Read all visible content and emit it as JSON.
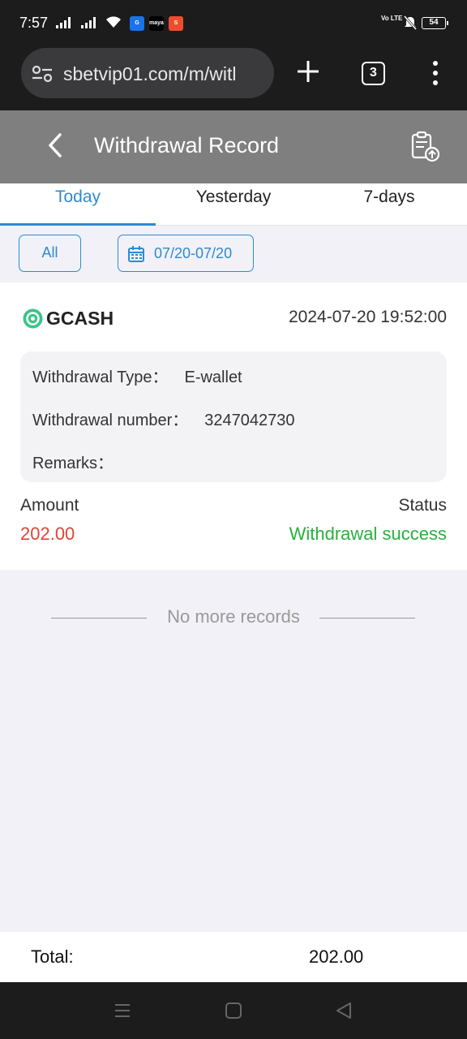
{
  "status_bar": {
    "time": "7:57",
    "volte": "Vo LTE",
    "battery": "54",
    "app_icons": [
      {
        "name": "gcash-app-icon",
        "label": "G",
        "color": "#1a73e8"
      },
      {
        "name": "maya-app-icon",
        "label": "maya",
        "color": "#000000"
      },
      {
        "name": "shopee-app-icon",
        "label": "S",
        "color": "#ee4d2d"
      }
    ]
  },
  "browser": {
    "url": "sbetvip01.com/m/witl",
    "tab_count": "3"
  },
  "header": {
    "title": "Withdrawal Record"
  },
  "tabs": [
    {
      "label": "Today",
      "active": true
    },
    {
      "label": "Yesterday",
      "active": false
    },
    {
      "label": "7-days",
      "active": false
    }
  ],
  "filter": {
    "all_label": "All",
    "date_range": "07/20-07/20"
  },
  "record": {
    "method": "GCASH",
    "datetime": "2024-07-20 19:52:00",
    "type_label": "Withdrawal Type：",
    "type_value": "E-wallet",
    "number_label": "Withdrawal number：",
    "number_value": "3247042730",
    "remarks_label": "Remarks：",
    "remarks_value": "",
    "amount_label": "Amount",
    "amount_value": "202.00",
    "status_label": "Status",
    "status_value": "Withdrawal success"
  },
  "list_end": "No more records",
  "total": {
    "label": "Total:",
    "value": "202.00"
  },
  "colors": {
    "accent": "#2f8ad0",
    "amount": "#e04434",
    "success": "#27b13d",
    "header_bg": "#7f7f7f"
  }
}
